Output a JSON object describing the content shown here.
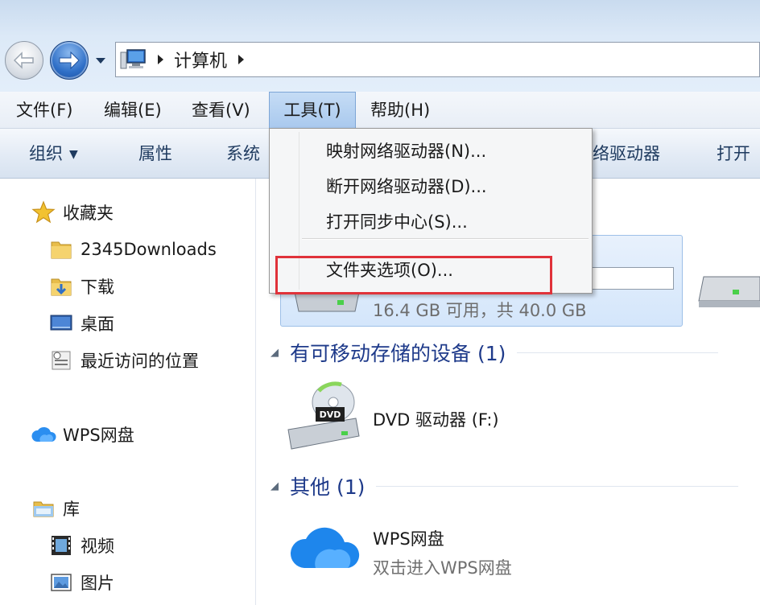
{
  "address": {
    "path": [
      "计算机"
    ],
    "icons": {
      "back": "back-arrow-icon",
      "forward": "forward-arrow-icon",
      "computer": "computer-icon"
    }
  },
  "menubar": {
    "items": [
      {
        "label": "文件(F)"
      },
      {
        "label": "编辑(E)"
      },
      {
        "label": "查看(V)"
      },
      {
        "label": "工具(T)"
      },
      {
        "label": "帮助(H)"
      }
    ],
    "active_index": 3
  },
  "cmdbar": {
    "organize": "组织",
    "properties": "属性",
    "system_partial": "系统",
    "network_partial": "络驱动器",
    "open_partial": "打开"
  },
  "navpane": {
    "favorites": "收藏夹",
    "fav_items": [
      "2345Downloads",
      "下载",
      "桌面",
      "最近访问的位置"
    ],
    "wps": "WPS网盘",
    "libraries": "库",
    "lib_items": [
      "视频",
      "图片"
    ]
  },
  "content": {
    "drive_free": "16.4 GB 可用，共 40.0 GB",
    "removable_group": "有可移动存储的设备 (1)",
    "dvd_label": "DVD 驱动器 (F:)",
    "dvd_badge": "DVD",
    "other_group": "其他 (1)",
    "wps_title": "WPS网盘",
    "wps_sub": "双击进入WPS网盘"
  },
  "dropdown": {
    "items": [
      "映射网络驱动器(N)...",
      "断开网络驱动器(D)...",
      "打开同步中心(S)...",
      "文件夹选项(O)..."
    ]
  },
  "colors": {
    "highlight": "#e0323a",
    "group_title": "#1e3a8a",
    "menu_active": "#a9c9ee"
  }
}
